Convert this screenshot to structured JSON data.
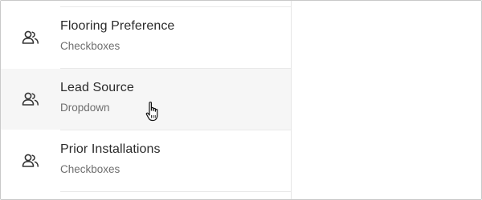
{
  "fields": [
    {
      "title": "Flooring Preference",
      "type": "Checkboxes",
      "icon": "contacts-icon"
    },
    {
      "title": "Lead Source",
      "type": "Dropdown",
      "icon": "contacts-icon",
      "hovered": true
    },
    {
      "title": "Prior Installations",
      "type": "Checkboxes",
      "icon": "contacts-icon"
    }
  ],
  "colors": {
    "hover_row_bg": "#f6f6f6",
    "title_text": "#2b2b2b",
    "subtitle_text": "#6e6e6e",
    "divider": "#e9e9e9"
  },
  "cursor": "hand-pointer"
}
